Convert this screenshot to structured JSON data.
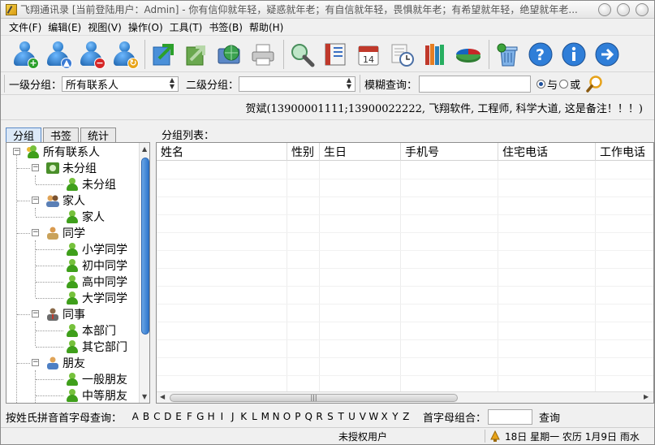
{
  "window": {
    "title": "飞翔通讯录  [当前登陆用户：Admin]  -  你有信仰就年轻，疑惑就年老；有自信就年轻，畏惧就年老；有希望就年轻，绝望就年老..."
  },
  "menu": [
    "文件(F)",
    "编辑(E)",
    "视图(V)",
    "操作(O)",
    "工具(T)",
    "书签(B)",
    "帮助(H)"
  ],
  "toolbar": {
    "icons": [
      "add-contact-icon",
      "upload-contact-icon",
      "remove-contact-icon",
      "refresh-contact-icon",
      "import-icon",
      "export-icon",
      "globe-icon",
      "printer-icon",
      "search-icon",
      "bookmark-icon",
      "calendar-icon",
      "clock-icon",
      "library-icon",
      "pie-chart-icon",
      "recycle-icon",
      "help-icon",
      "info-icon",
      "forward-icon"
    ]
  },
  "filter": {
    "level1_label": "一级分组：",
    "level1_value": "所有联系人",
    "level2_label": "二级分组：",
    "level2_value": "",
    "fuzzy_label": "模糊查询：",
    "fuzzy_value": "",
    "and_label": "与",
    "or_label": "或"
  },
  "info": {
    "text": "贺斌(13900001111;13900022222, 飞翔软件, 工程师, 科学大道, 这是备注！！！)"
  },
  "tabs": [
    "分组",
    "书签",
    "统计"
  ],
  "tree": {
    "root": "所有联系人",
    "nodes": [
      "未分组",
      "未分组",
      "家人",
      "家人",
      "同学",
      "小学同学",
      "初中同学",
      "高中同学",
      "大学同学",
      "同事",
      "本部门",
      "其它部门",
      "朋友",
      "一般朋友",
      "中等朋友"
    ]
  },
  "list": {
    "label": "分组列表：",
    "columns": [
      "姓名",
      "性别",
      "生日",
      "手机号",
      "住宅电话",
      "工作电话"
    ]
  },
  "alpha": {
    "label": "按姓氏拼音首字母查询：",
    "letters": [
      "A",
      "B",
      "C",
      "D",
      "E",
      "F",
      "G",
      "H",
      "I",
      "J",
      "K",
      "L",
      "M",
      "N",
      "O",
      "P",
      "Q",
      "R",
      "S",
      "T",
      "U",
      "V",
      "W",
      "X",
      "Y",
      "Z"
    ],
    "combo_label": "首字母组合：",
    "combo_value": "",
    "query_button": "查询"
  },
  "status": {
    "user": "未授权用户",
    "date": "18日 星期一 农历 1月9日  雨水"
  },
  "colors": {
    "accent": "#2e76cc",
    "group_green": "#3f9f1b"
  }
}
